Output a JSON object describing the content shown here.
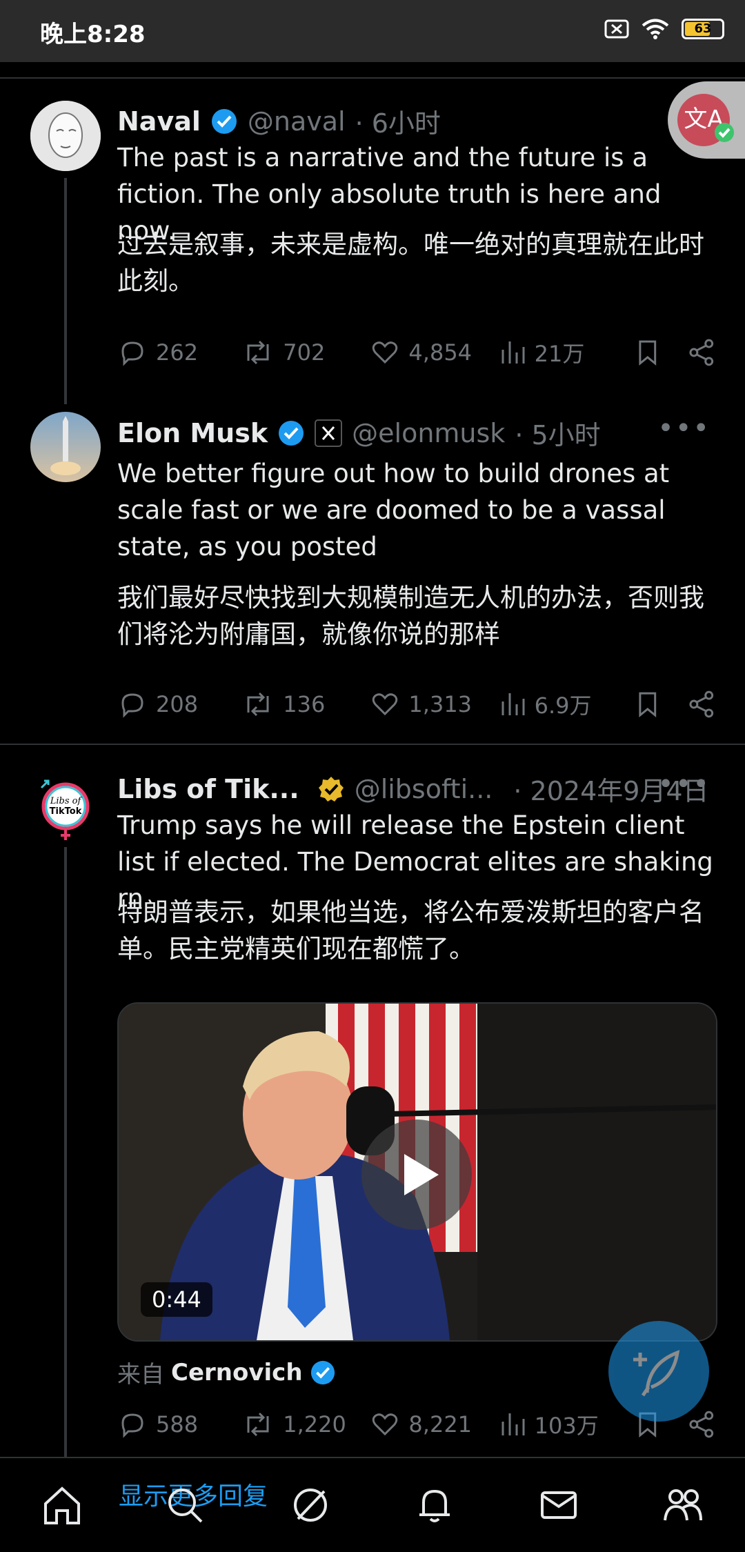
{
  "status_bar": {
    "time": "晚上8:28",
    "battery": "63"
  },
  "tweets": [
    {
      "name": "Naval",
      "handle": "@naval",
      "time": "· 6小时",
      "text": "The past is a narrative and the future is a fiction. The only absolute truth is here and now.",
      "translation": "过去是叙事，未来是虚构。唯一绝对的真理就在此时此刻。",
      "replies": "262",
      "retweets": "702",
      "likes": "4,854",
      "views": "21万"
    },
    {
      "name": "Elon Musk",
      "handle": "@elonmusk",
      "time": "· 5小时",
      "text": "We better figure out how to build drones at scale fast or we are doomed to be a vassal state, as you posted",
      "translation": "我们最好尽快找到大规模制造无人机的办法，否则我们将沦为附庸国，就像你说的那样",
      "replies": "208",
      "retweets": "136",
      "likes": "1,313",
      "views": "6.9万"
    },
    {
      "name": "Libs of Tik...",
      "handle": "@libsofti...",
      "time": "· 2024年9月4日",
      "text": "Trump says he will release the Epstein client list if elected. The Democrat elites are shaking rn",
      "translation": "特朗普表示，如果他当选，将公布爱泼斯坦的客户名单。民主党精英们现在都慌了。",
      "video_duration": "0:44",
      "from_label": "来自",
      "from_name": "Cernovich",
      "replies": "588",
      "retweets": "1,220",
      "likes": "8,221",
      "views": "103万"
    }
  ],
  "show_more": "显示更多回复",
  "icons": [
    "reply-icon",
    "retweet-icon",
    "like-icon",
    "views-icon",
    "bookmark-icon",
    "share-icon",
    "home-icon",
    "search-icon",
    "grok-icon",
    "notifications-icon",
    "messages-icon",
    "communities-icon",
    "compose-icon",
    "translate-icon"
  ],
  "colors": {
    "accent": "#1d9bf0",
    "muted": "#71767b",
    "gold": "#f4c430"
  }
}
